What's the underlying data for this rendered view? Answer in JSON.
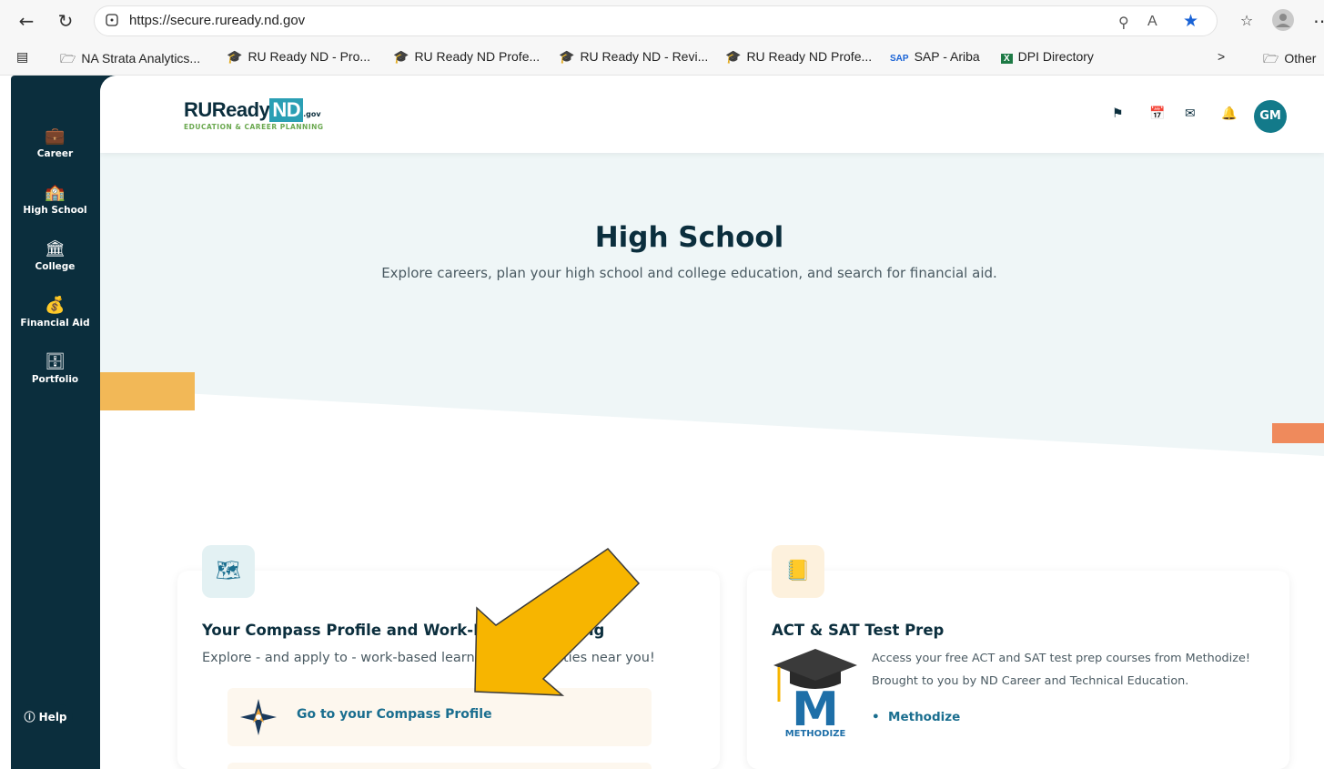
{
  "browser": {
    "url": "https://secure.ruready.nd.gov",
    "bookmarks": [
      {
        "label": "NA Strata Analytics...",
        "icon": "folder-icon"
      },
      {
        "label": "RU Ready ND - Pro...",
        "icon": "graduation-cap-icon"
      },
      {
        "label": "RU Ready ND Profe...",
        "icon": "graduation-cap-icon"
      },
      {
        "label": "RU Ready ND - Revi...",
        "icon": "graduation-cap-icon"
      },
      {
        "label": "RU Ready ND Profe...",
        "icon": "graduation-cap-icon"
      },
      {
        "label": "SAP - Ariba",
        "icon": "sap-icon"
      },
      {
        "label": "DPI Directory",
        "icon": "excel-icon"
      },
      {
        "label": "Other",
        "icon": "folder-icon"
      }
    ]
  },
  "sidebar": {
    "items": [
      {
        "label": "Career",
        "icon": "briefcase-icon"
      },
      {
        "label": "High School",
        "icon": "school-icon"
      },
      {
        "label": "College",
        "icon": "college-icon"
      },
      {
        "label": "Financial Aid",
        "icon": "money-bag-icon"
      },
      {
        "label": "Portfolio",
        "icon": "portfolio-icon"
      }
    ],
    "help_label": "Help"
  },
  "header": {
    "logo_main": "RUReady",
    "logo_nd": "ND",
    "logo_gov": ".gov",
    "logo_sub": "EDUCATION & CAREER PLANNING",
    "avatar_initials": "GM"
  },
  "hero": {
    "title": "High School",
    "subtitle": "Explore careers, plan your high school and college education, and search for financial aid."
  },
  "cards": {
    "compass": {
      "title": "Your Compass Profile and Work-Based Learning",
      "description": "Explore - and apply to - work-based learning opportunities near you!",
      "link_label": "Go to your Compass Profile"
    },
    "test_prep": {
      "title": "ACT & SAT Test Prep",
      "description_line1": "Access your free ACT and SAT test prep courses from Methodize!",
      "description_line2": "Brought to you by ND Career and Technical Education.",
      "link_label": "Methodize",
      "logo_text": "METHODIZE",
      "logo_letter": "M"
    }
  },
  "colors": {
    "sidebar": "#0b2e3d",
    "accent": "#2a9fb4",
    "arrow": "#f7b500"
  }
}
